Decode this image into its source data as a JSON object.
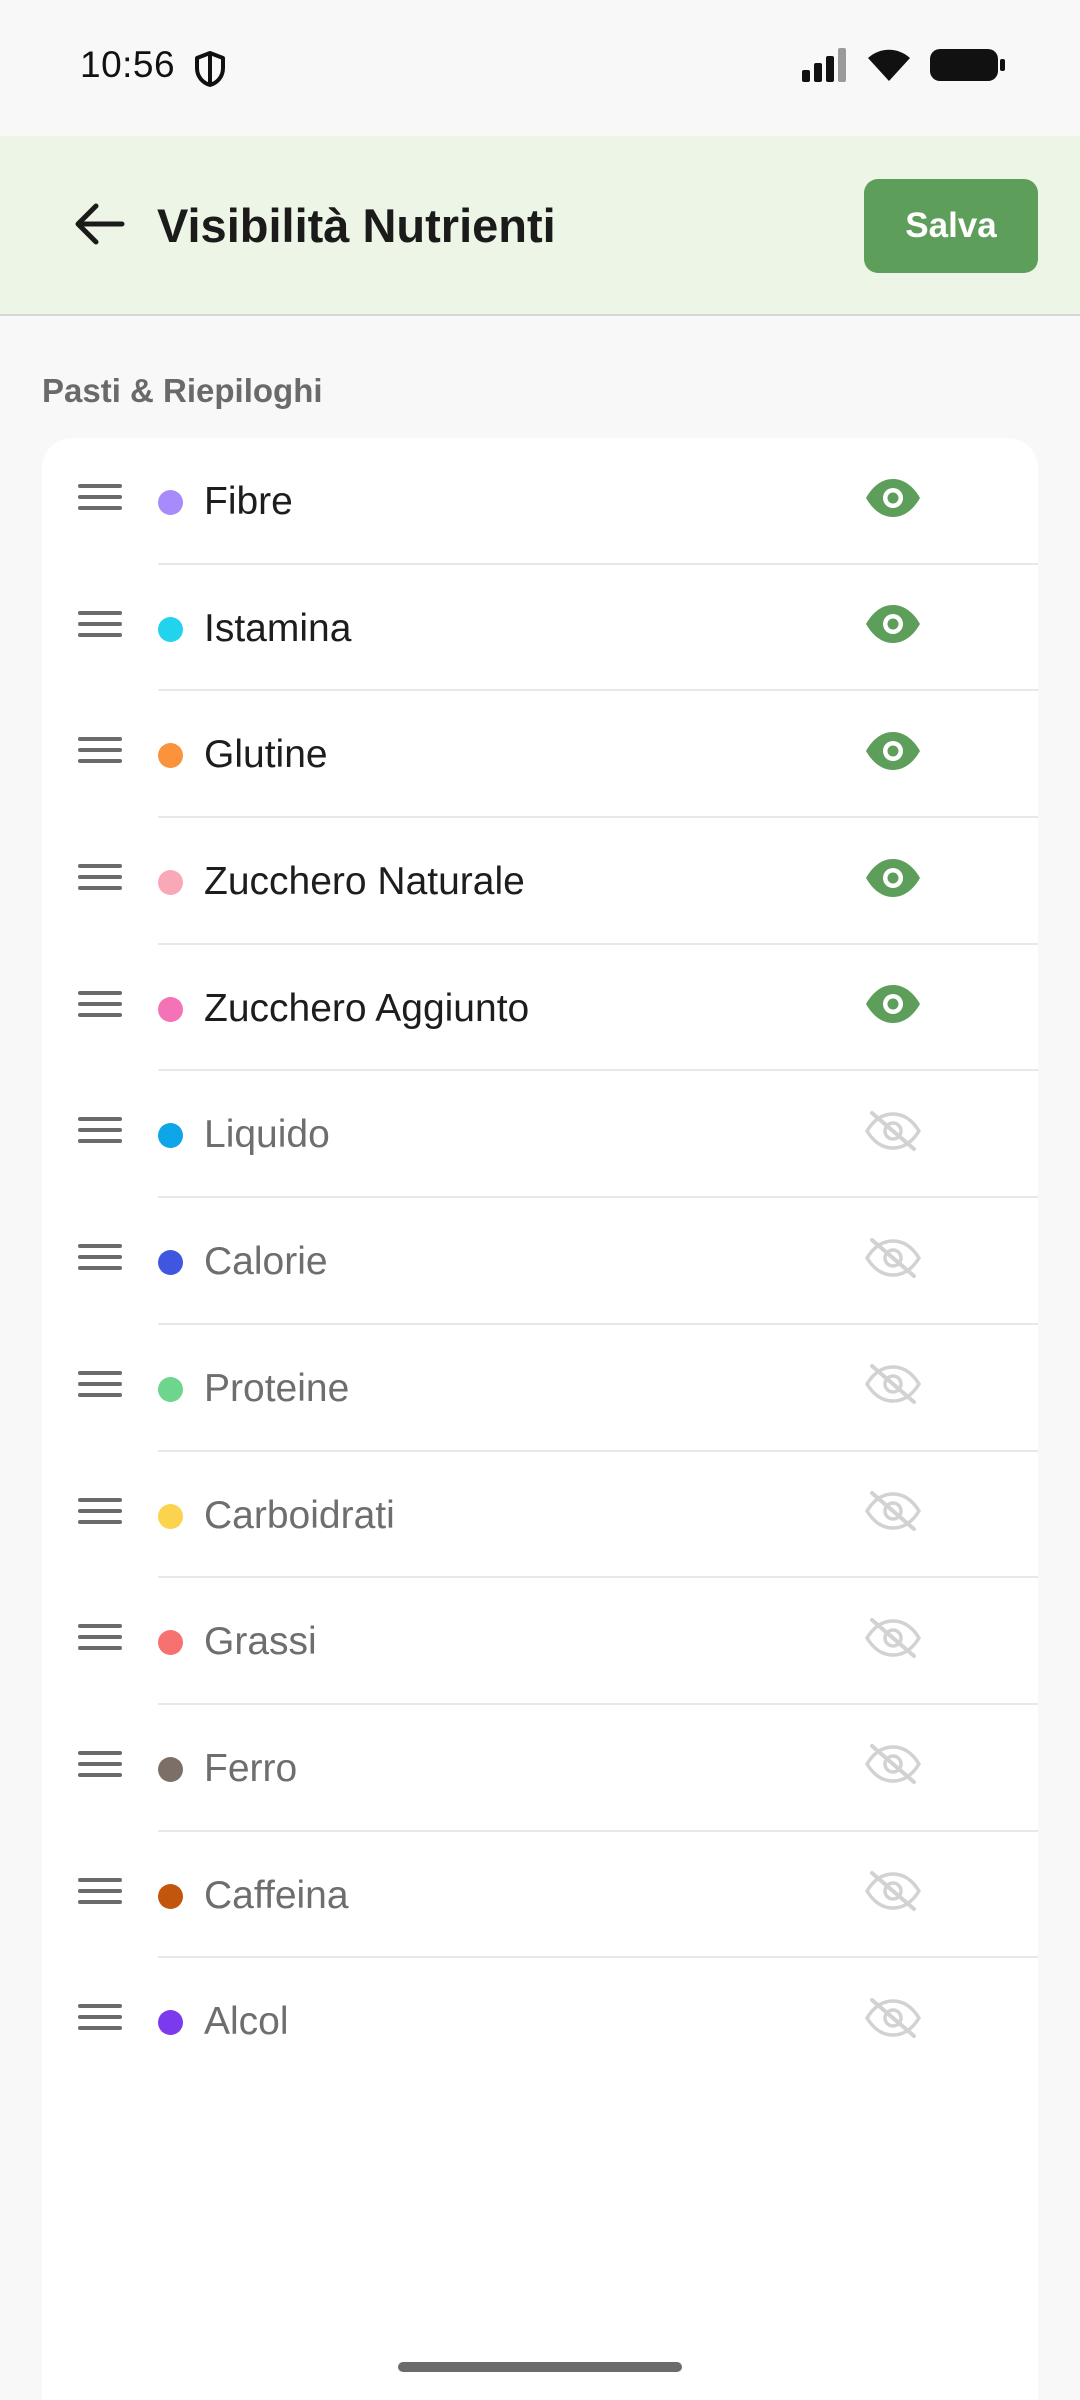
{
  "status_bar": {
    "time": "10:56",
    "icons": [
      "shield-icon",
      "signal-icon",
      "wifi-icon",
      "battery-icon"
    ]
  },
  "app_bar": {
    "back_icon": "arrow-left-icon",
    "title": "Visibilità Nutrienti",
    "save_label": "Salva"
  },
  "section": {
    "label": "Pasti & Riepiloghi"
  },
  "colors": {
    "accent": "#5d9e5a",
    "app_bar_bg": "#ecf5e6",
    "visible_icon": "#5d9e5a",
    "hidden_icon": "#d2d2d2"
  },
  "nutrients": [
    {
      "name": "Fibre",
      "color": "#a78bfa",
      "visible": true
    },
    {
      "name": "Istamina",
      "color": "#22d3ee",
      "visible": true
    },
    {
      "name": "Glutine",
      "color": "#fb923c",
      "visible": true
    },
    {
      "name": "Zucchero Naturale",
      "color": "#f9a8b8",
      "visible": true
    },
    {
      "name": "Zucchero Aggiunto",
      "color": "#f472b6",
      "visible": true
    },
    {
      "name": "Liquido",
      "color": "#0ea5e9",
      "visible": false
    },
    {
      "name": "Calorie",
      "color": "#3f56e0",
      "visible": false
    },
    {
      "name": "Proteine",
      "color": "#6dd58c",
      "visible": false
    },
    {
      "name": "Carboidrati",
      "color": "#fcd34d",
      "visible": false
    },
    {
      "name": "Grassi",
      "color": "#f87171",
      "visible": false
    },
    {
      "name": "Ferro",
      "color": "#7c6f68",
      "visible": false
    },
    {
      "name": "Caffeina",
      "color": "#c2560c",
      "visible": false
    },
    {
      "name": "Alcol",
      "color": "#7c3aed",
      "visible": false
    }
  ]
}
